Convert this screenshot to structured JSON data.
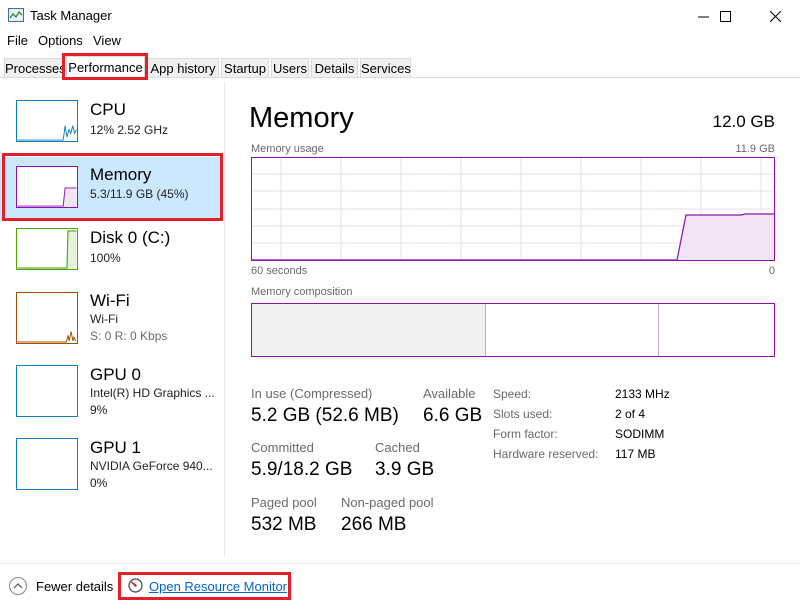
{
  "window": {
    "title": "Task Manager"
  },
  "menu": [
    "File",
    "Options",
    "View"
  ],
  "tabs": [
    "Processes",
    "Performance",
    "App history",
    "Startup",
    "Users",
    "Details",
    "Services"
  ],
  "active_tab": "Performance",
  "sidebar": [
    {
      "title": "CPU",
      "line1": "12%  2.52 GHz",
      "line2": "",
      "color": "#117dbb"
    },
    {
      "title": "Memory",
      "line1": "5.3/11.9 GB (45%)",
      "line2": "",
      "color": "#8b12ae"
    },
    {
      "title": "Disk 0 (C:)",
      "line1": "100%",
      "line2": "",
      "color": "#4da60c"
    },
    {
      "title": "Wi-Fi",
      "line1": "Wi-Fi",
      "line2": "S: 0 R: 0 Kbps",
      "color": "#a74f01"
    },
    {
      "title": "GPU 0",
      "line1": "Intel(R) HD Graphics ...",
      "line2": "9%",
      "color": "#117dbb"
    },
    {
      "title": "GPU 1",
      "line1": "NVIDIA GeForce 940...",
      "line2": "0%",
      "color": "#117dbb"
    }
  ],
  "main": {
    "title": "Memory",
    "total": "12.0 GB",
    "usage_label": "Memory usage",
    "usage_max": "11.9 GB",
    "time_left": "60 seconds",
    "time_right": "0",
    "composition_label": "Memory composition",
    "accent": "#8b12ae"
  },
  "stats": {
    "in_use_label": "In use (Compressed)",
    "in_use_value": "5.2 GB (52.6 MB)",
    "available_label": "Available",
    "available_value": "6.6 GB",
    "committed_label": "Committed",
    "committed_value": "5.9/18.2 GB",
    "cached_label": "Cached",
    "cached_value": "3.9 GB",
    "paged_label": "Paged pool",
    "paged_value": "532 MB",
    "nonpaged_label": "Non-paged pool",
    "nonpaged_value": "266 MB"
  },
  "specs": [
    {
      "label": "Speed:",
      "value": "2133 MHz"
    },
    {
      "label": "Slots used:",
      "value": "2 of 4"
    },
    {
      "label": "Form factor:",
      "value": "SODIMM"
    },
    {
      "label": "Hardware reserved:",
      "value": "117 MB"
    }
  ],
  "footer": {
    "fewer_details": "Fewer details",
    "resource_monitor": "Open Resource Monitor"
  }
}
